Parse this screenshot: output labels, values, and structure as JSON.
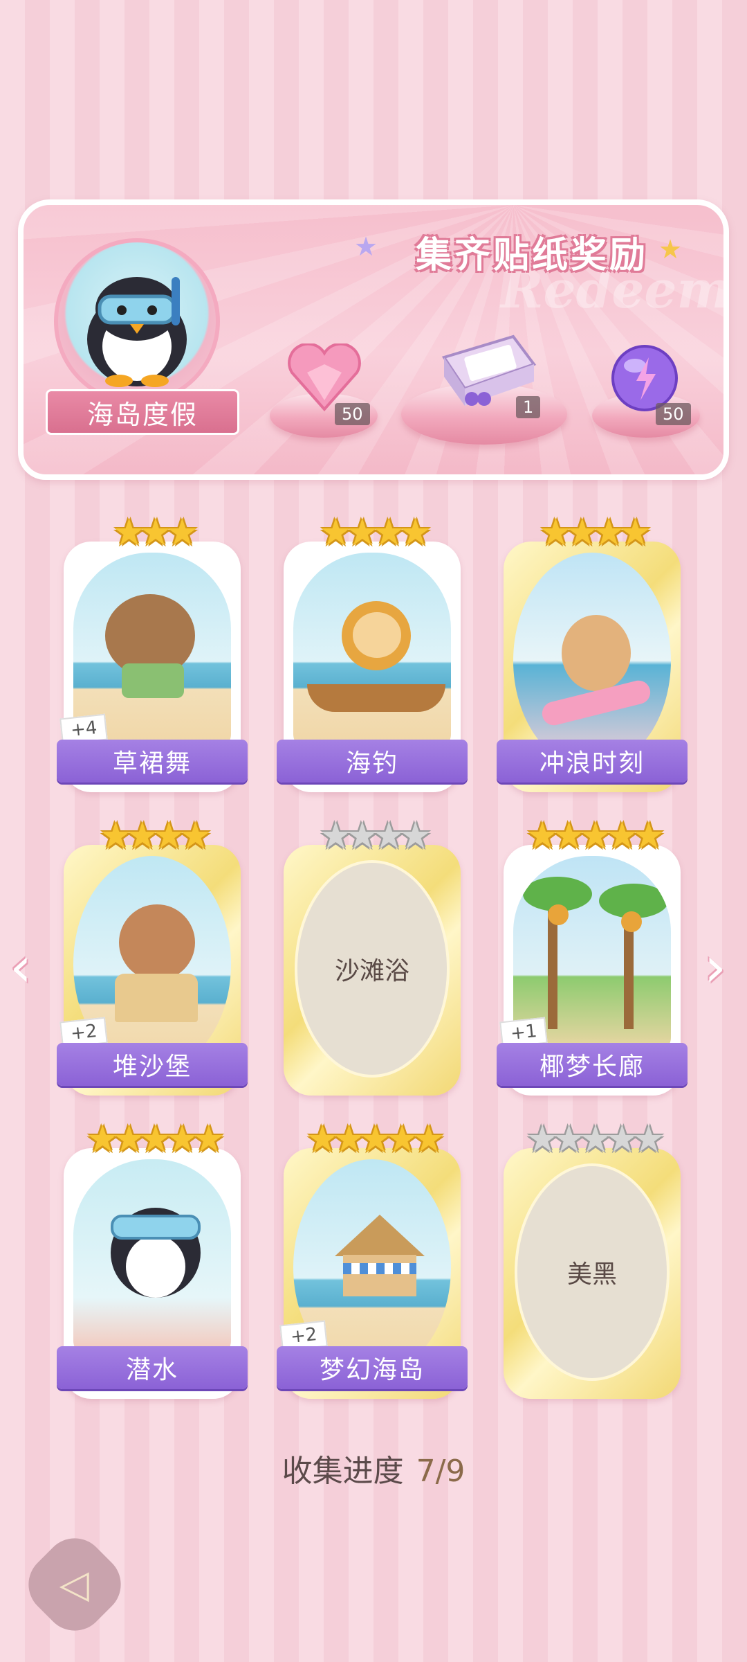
{
  "banner": {
    "title": "集齐贴纸奖励",
    "watermark": "Redeem",
    "badge_label": "海岛度假",
    "rewards": [
      {
        "icon": "pink-heart-gem-icon",
        "count": "50"
      },
      {
        "icon": "gift-box-icon",
        "count": "1"
      },
      {
        "icon": "purple-energy-orb-icon",
        "count": "50"
      }
    ]
  },
  "cards": [
    {
      "title": "草裙舞",
      "stars": 3,
      "collected": true,
      "extra": "+4",
      "style": "white"
    },
    {
      "title": "海钓",
      "stars": 4,
      "collected": true,
      "extra": "",
      "style": "white"
    },
    {
      "title": "冲浪时刻",
      "stars": 4,
      "collected": true,
      "extra": "",
      "style": "gold"
    },
    {
      "title": "堆沙堡",
      "stars": 4,
      "collected": true,
      "extra": "+2",
      "style": "gold"
    },
    {
      "title": "沙滩浴",
      "stars": 4,
      "collected": false,
      "extra": "",
      "style": "gold"
    },
    {
      "title": "椰梦长廊",
      "stars": 5,
      "collected": true,
      "extra": "+1",
      "style": "white"
    },
    {
      "title": "潜水",
      "stars": 5,
      "collected": true,
      "extra": "",
      "style": "white"
    },
    {
      "title": "梦幻海岛",
      "stars": 5,
      "collected": true,
      "extra": "+2",
      "style": "gold"
    },
    {
      "title": "美黑",
      "stars": 5,
      "collected": false,
      "extra": "",
      "style": "gold"
    }
  ],
  "progress": {
    "label": "收集进度",
    "value": "7/9"
  },
  "colors": {
    "accent_purple": "#8b62d6",
    "pink": "#f4b9c8",
    "gold_star": "#f8c531"
  }
}
